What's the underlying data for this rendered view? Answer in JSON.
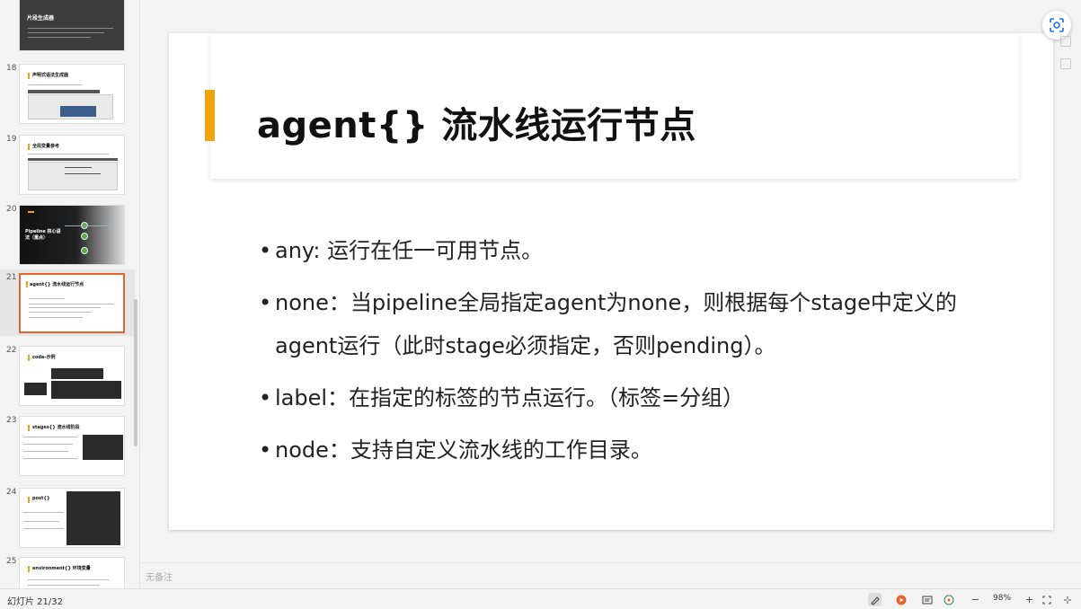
{
  "thumbnails": [
    {
      "num": "",
      "title": "片段生成器",
      "style": "gray"
    },
    {
      "num": "18",
      "title": "声明式语法生成器",
      "style": "shots"
    },
    {
      "num": "19",
      "title": "全局变量参考",
      "style": "shots2"
    },
    {
      "num": "20",
      "title": "Pipeline 核心语法（重点）",
      "style": "dark"
    },
    {
      "num": "21",
      "title": "agent{} 流水线运行节点",
      "style": "text",
      "selected": true
    },
    {
      "num": "22",
      "title": "code-示例",
      "style": "code"
    },
    {
      "num": "23",
      "title": "stages{} 流水线阶段",
      "style": "code2"
    },
    {
      "num": "24",
      "title": "post{}",
      "style": "code3"
    },
    {
      "num": "25",
      "title": "environment{} 环境变量",
      "style": "text"
    }
  ],
  "slide": {
    "title": "agent{} 流水线运行节点",
    "bullets": [
      "any: 运行在任一可用节点。",
      "none：当pipeline全局指定agent为none，则根据每个stage中定义的agent运行（此时stage必须指定，否则pending）。",
      "label：在指定的标签的节点运行。（标签=分组）",
      "node：支持自定义流水线的工作目录。"
    ]
  },
  "notes": {
    "placeholder": "无备注"
  },
  "status": {
    "slide_counter": "幻灯片 21/32",
    "zoom": "98%"
  },
  "colors": {
    "accent": "#f0a30a",
    "selected_border": "#e8632b"
  },
  "icons": [
    "screenshot-icon",
    "annotate-icon",
    "play-icon",
    "notes-icon",
    "comment-icon",
    "zoom-out-icon",
    "zoom-in-icon",
    "fit-icon",
    "fullscreen-icon"
  ]
}
